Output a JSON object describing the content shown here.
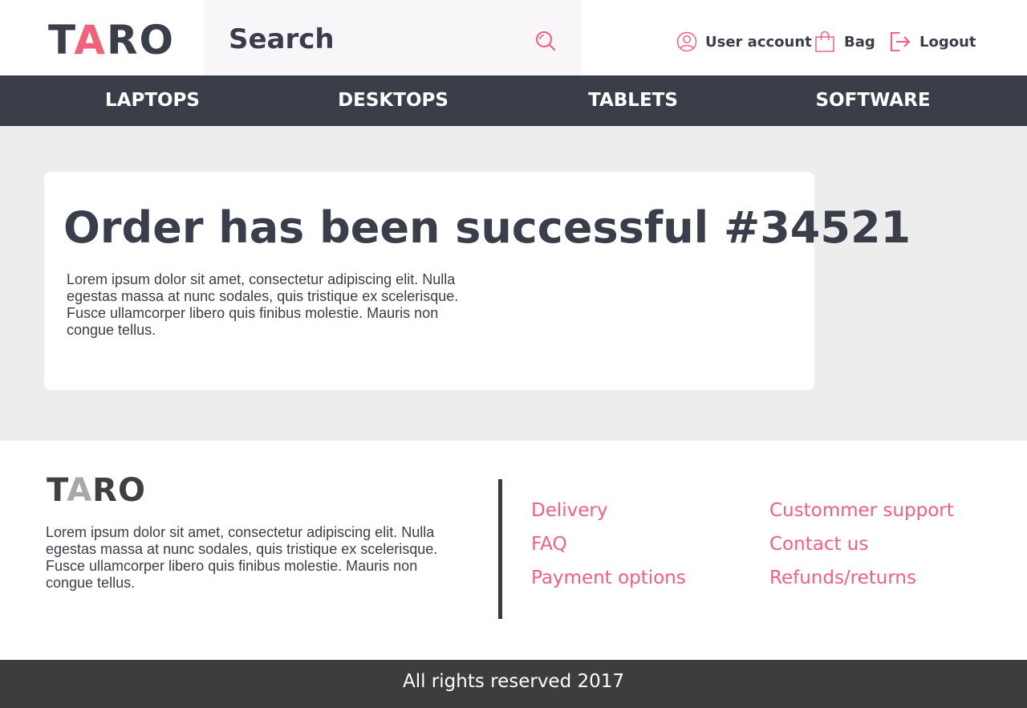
{
  "brand": {
    "logo_first": "T",
    "logo_accent": "A",
    "logo_rest": "RO",
    "accent_color": "#f2617a",
    "dark_color": "#3a3e48"
  },
  "search": {
    "placeholder": "Search",
    "icon": "search-icon"
  },
  "header_actions": {
    "user_account": "User account",
    "bag": "Bag",
    "logout": "Logout"
  },
  "nav": {
    "items": [
      "LAPTOPS",
      "DESKTOPS",
      "TABLETS",
      "SOFTWARE"
    ]
  },
  "main": {
    "title": "Order has been successful #34521",
    "body": " Lorem ipsum dolor sit amet, consectetur adipiscing elit. Nulla egestas massa at nunc sodales, quis tristique ex scelerisque. Fusce ullamcorper libero quis finibus molestie. Mauris non congue tellus."
  },
  "footer": {
    "logo_first": "T",
    "logo_accent": "A",
    "logo_rest": "RO",
    "text": "Lorem ipsum dolor sit amet, consectetur adipiscing elit. Nulla egestas massa at nunc sodales, quis tristique ex scelerisque. Fusce ullamcorper libero quis finibus molestie. Mauris non congue tellus.",
    "links_left": [
      "Delivery",
      "FAQ",
      "Payment options"
    ],
    "links_right": [
      "Custommer support",
      "Contact us",
      "Refunds/returns"
    ]
  },
  "bottom_bar": {
    "copyright": "All rights reserved 2017"
  }
}
